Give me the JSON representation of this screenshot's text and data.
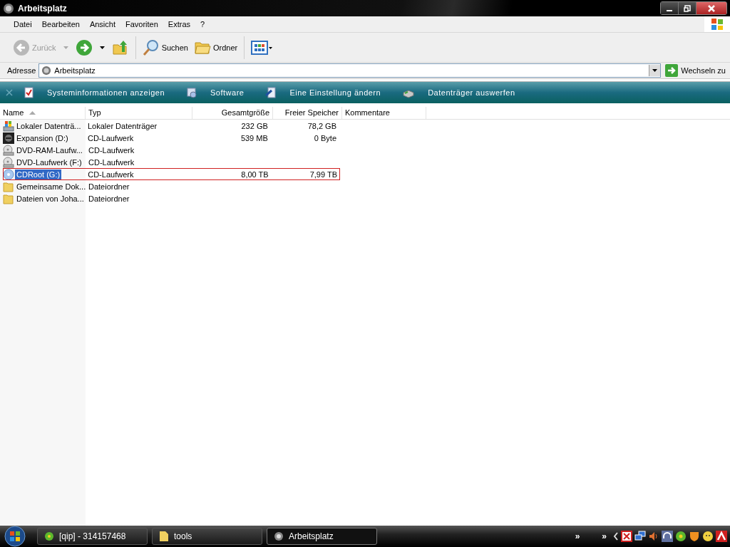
{
  "window": {
    "title": "Arbeitsplatz"
  },
  "menu": [
    "Datei",
    "Bearbeiten",
    "Ansicht",
    "Favoriten",
    "Extras",
    "?"
  ],
  "toolbar": {
    "back": {
      "label": "Zurück",
      "disabled": true
    },
    "search": "Suchen",
    "folders": "Ordner"
  },
  "address": {
    "label": "Adresse",
    "value": "Arbeitsplatz",
    "go": "Wechseln zu"
  },
  "tasks": [
    {
      "kind": "info",
      "label": "Systeminformationen anzeigen"
    },
    {
      "kind": "software",
      "label": "Software"
    },
    {
      "kind": "settings",
      "label": "Eine Einstellung ändern"
    },
    {
      "kind": "eject",
      "label": "Datenträger auswerfen"
    }
  ],
  "table": {
    "columns": [
      "Name",
      "Typ",
      "Gesamtgröße",
      "Freier Speicher",
      "Kommentare"
    ],
    "rows": [
      {
        "kind": "drive",
        "name": "Lokaler Datenträ...",
        "type": "Lokaler Datenträger",
        "total": "232 GB",
        "free": "78,2 GB",
        "selected": false,
        "outlined": false
      },
      {
        "kind": "game",
        "name": "Expansion (D:)",
        "type": "CD-Laufwerk",
        "total": "539 MB",
        "free": "0 Byte",
        "selected": false,
        "outlined": false
      },
      {
        "kind": "dvd",
        "name": "DVD-RAM-Laufw...",
        "type": "CD-Laufwerk",
        "selected": false,
        "outlined": false
      },
      {
        "kind": "dvd",
        "name": "DVD-Laufwerk (F:)",
        "type": "CD-Laufwerk",
        "selected": false,
        "outlined": false
      },
      {
        "kind": "cd",
        "name": "CDRoot (G:)",
        "type": "CD-Laufwerk",
        "total": "8,00 TB",
        "free": "7,99 TB",
        "selected": true,
        "outlined": true
      },
      {
        "kind": "folder",
        "name": "Gemeinsame Dok...",
        "type": "Dateiordner",
        "selected": false,
        "outlined": false
      },
      {
        "kind": "folder",
        "name": "Dateien von Joha...",
        "type": "Dateiordner",
        "selected": false,
        "outlined": false
      }
    ]
  },
  "taskbar": {
    "buttons": [
      {
        "kind": "qip",
        "label": "[qip] - 314157468",
        "selected": false
      },
      {
        "kind": "folder",
        "label": "tools",
        "selected": false
      },
      {
        "kind": "computer",
        "label": "Arbeitsplatz",
        "selected": true
      }
    ],
    "chevrons": [
      "»",
      "»"
    ]
  }
}
